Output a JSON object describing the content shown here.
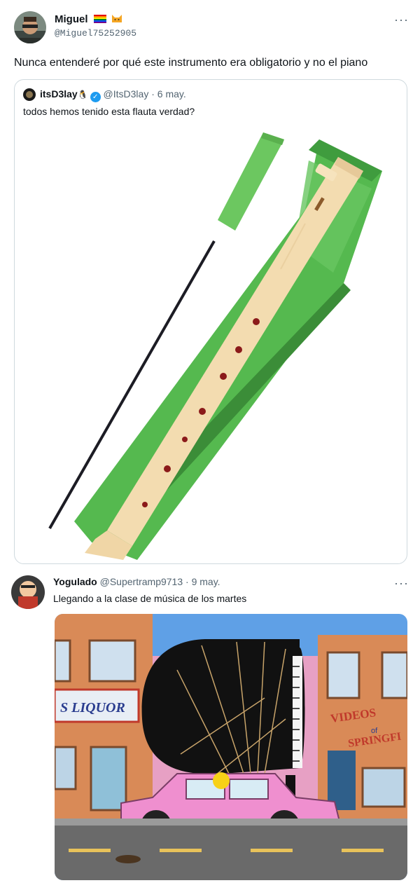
{
  "tweet": {
    "author_name": "Miguel",
    "author_handle": "@Miguel75252905",
    "text": "Nunca entenderé por qué este instrumento era obligatorio y no el piano",
    "more_icon": "···"
  },
  "quote": {
    "author_name": "itsD3lay",
    "author_handle": "@ItsD3lay",
    "date": "· 6 may.",
    "text": "todos hemos tenido esta flauta verdad?",
    "verified_glyph": "✓",
    "penguin_glyph": "🐧"
  },
  "reply": {
    "author_name": "Yogulado",
    "author_handle": "@Supertramp9713",
    "date": "· 9 may.",
    "text": "Llegando a la clase de música de los martes",
    "more_icon": "···",
    "image_signs": {
      "liquor": "S LIQUOR",
      "videos_top": "VIDEOS",
      "videos_of": "of",
      "videos_bottom": "SPRINGFI"
    }
  },
  "colors": {
    "text": "#0f1419",
    "secondary": "#536471",
    "verified": "#1d9bf0",
    "border": "#cfd9de",
    "sleeve_green": "#55b94f",
    "recorder": "#f3dcb0"
  }
}
